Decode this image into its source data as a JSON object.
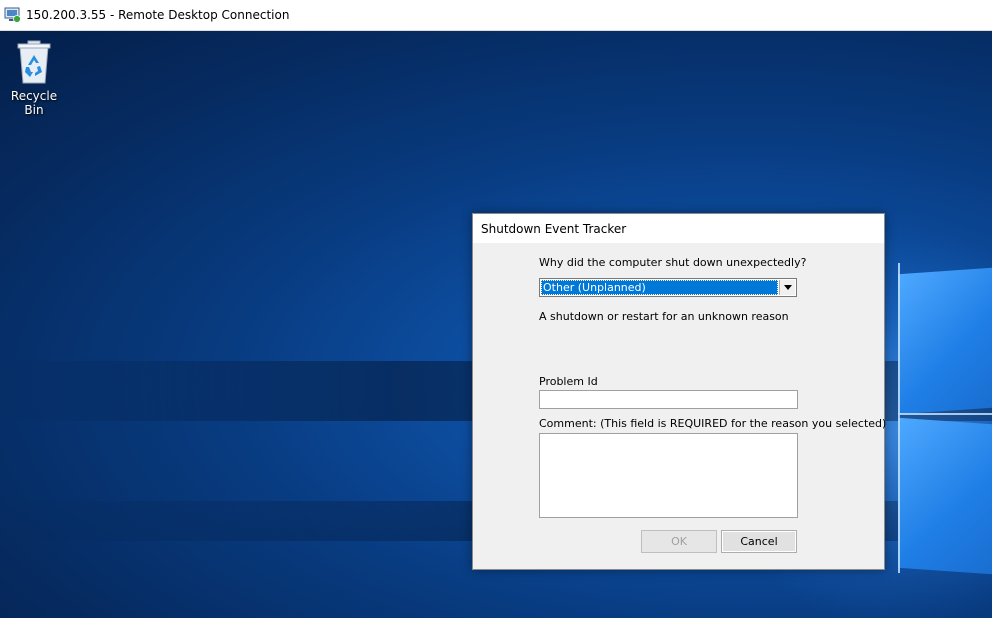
{
  "window": {
    "title": "150.200.3.55 - Remote Desktop Connection",
    "icon": "remote-desktop-icon"
  },
  "desktop": {
    "icons": [
      {
        "label": "Recycle Bin",
        "icon": "recycle-bin-icon"
      }
    ]
  },
  "dialog": {
    "title": "Shutdown Event Tracker",
    "question": "Why did the computer shut down unexpectedly?",
    "reason_selected": "Other (Unplanned)",
    "reason_description": "A shutdown or restart for an unknown reason",
    "problem_id_label": "Problem Id",
    "problem_id_value": "",
    "comment_label": "Comment: (This field is REQUIRED for the reason you selected)",
    "comment_value": "",
    "ok_label": "OK",
    "cancel_label": "Cancel"
  },
  "colors": {
    "selection": "#0078d7",
    "desktop_dark": "#041f4a",
    "desktop_light": "#1a6fd0"
  }
}
